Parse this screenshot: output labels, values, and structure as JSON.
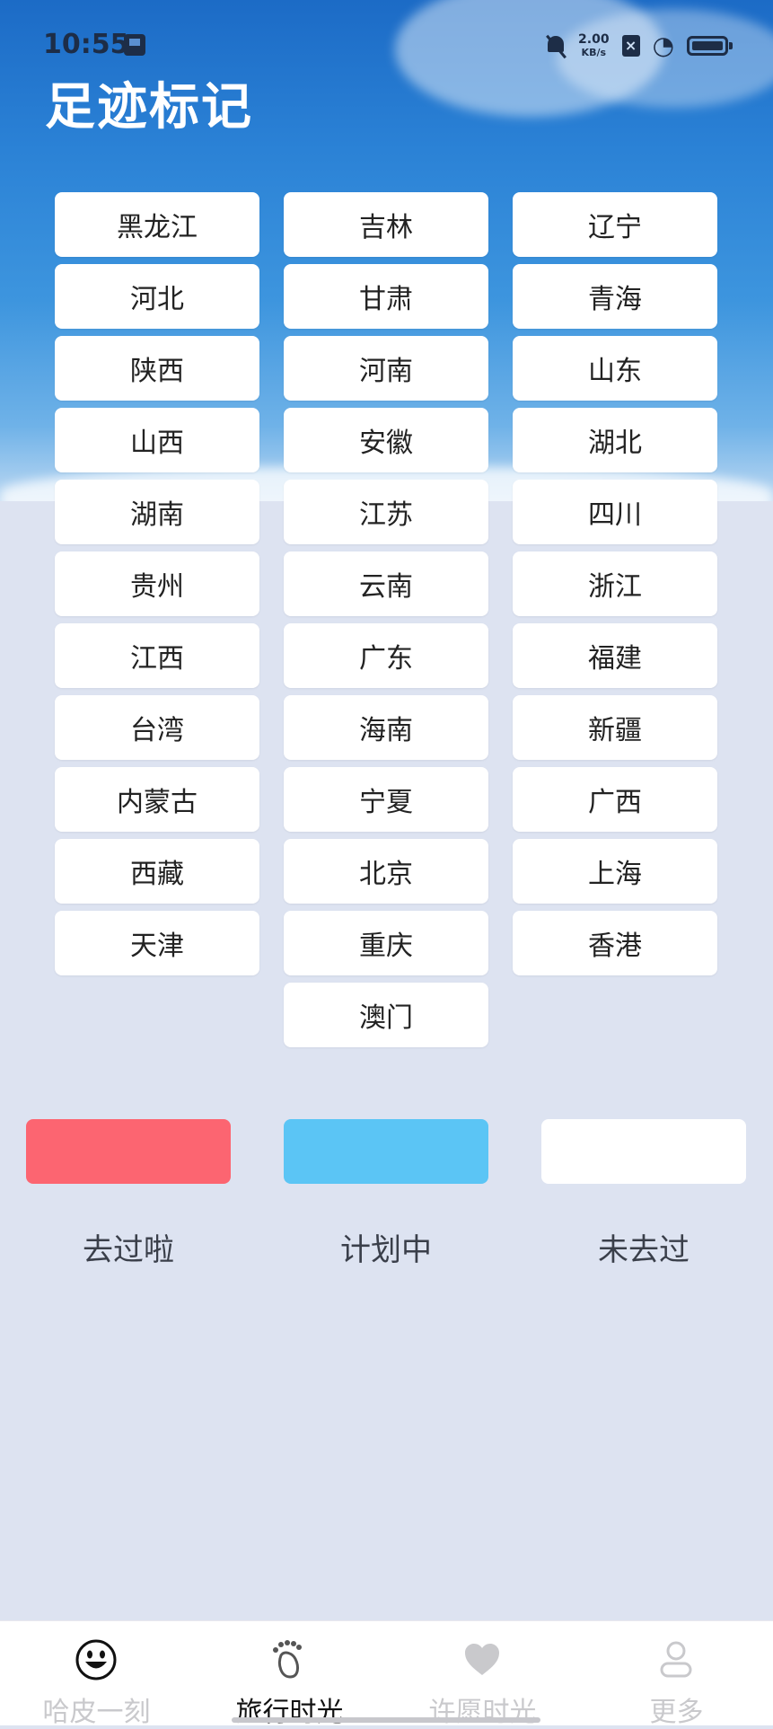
{
  "status_bar": {
    "time": "10:55",
    "net_speed_value": "2.00",
    "net_speed_unit": "KB/s"
  },
  "header": {
    "title": "足迹标记"
  },
  "provinces": [
    "黑龙江",
    "吉林",
    "辽宁",
    "河北",
    "甘肃",
    "青海",
    "陕西",
    "河南",
    "山东",
    "山西",
    "安徽",
    "湖北",
    "湖南",
    "江苏",
    "四川",
    "贵州",
    "云南",
    "浙江",
    "江西",
    "广东",
    "福建",
    "台湾",
    "海南",
    "新疆",
    "内蒙古",
    "宁夏",
    "广西",
    "西藏",
    "北京",
    "上海",
    "天津",
    "重庆",
    "香港",
    "澳门"
  ],
  "legend": {
    "visited": {
      "label": "去过啦",
      "color": "#fc6571"
    },
    "planning": {
      "label": "计划中",
      "color": "#5bc5f5"
    },
    "not_visited": {
      "label": "未去过",
      "color": "#ffffff"
    }
  },
  "tabbar": {
    "items": [
      {
        "label": "哈皮一刻",
        "icon": "smiley-icon",
        "active": false
      },
      {
        "label": "旅行时光",
        "icon": "footprint-icon",
        "active": true
      },
      {
        "label": "许愿时光",
        "icon": "heart-icon",
        "active": false
      },
      {
        "label": "更多",
        "icon": "person-icon",
        "active": false
      }
    ]
  }
}
